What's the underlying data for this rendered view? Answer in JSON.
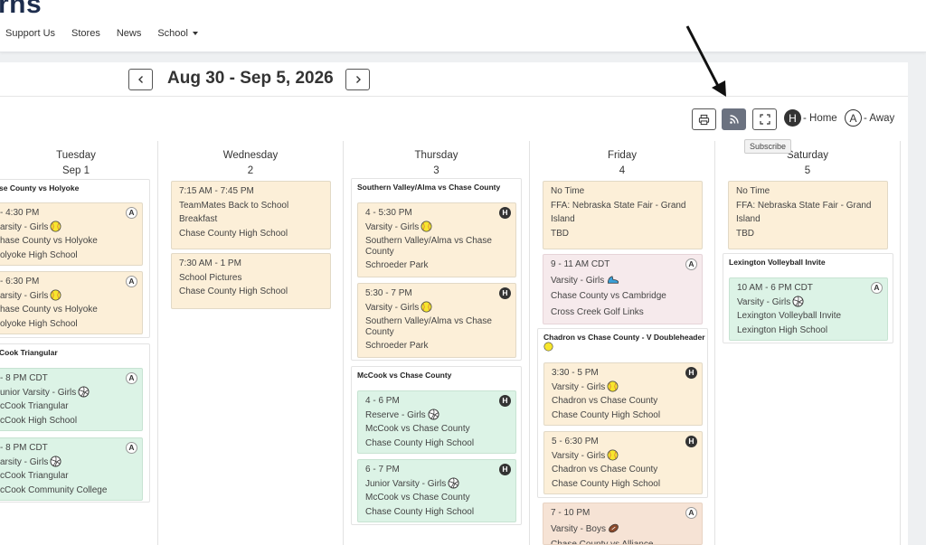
{
  "header": {
    "brand": "rns",
    "nav": [
      "Support Us",
      "Stores",
      "News",
      "School"
    ]
  },
  "week": {
    "title": "Aug 30 - Sep 5, 2026"
  },
  "toolbar": {
    "tooltip": "Subscribe"
  },
  "legend": {
    "home_letter": "H",
    "home_label": "- Home",
    "away_letter": "A",
    "away_label": "- Away"
  },
  "days": [
    {
      "name": "Tuesday",
      "date": "Sep 1"
    },
    {
      "name": "Wednesday",
      "date": "2"
    },
    {
      "name": "Thursday",
      "date": "3"
    },
    {
      "name": "Friday",
      "date": "4"
    },
    {
      "name": "Saturday",
      "date": "5"
    }
  ],
  "tuesday": {
    "g1": {
      "title": "se County vs Holyoke",
      "e1": {
        "time": "- 4:30 PM",
        "level": "arsity - Girls",
        "match": "hase County vs Holyoke",
        "venue": "olyoke High School",
        "badge": "A"
      },
      "e2": {
        "time": "- 6:30 PM",
        "level": "arsity - Girls",
        "match": "hase County vs Holyoke",
        "venue": "olyoke High School",
        "badge": "A"
      }
    },
    "g2": {
      "title": "Cook Triangular",
      "e1": {
        "time": "- 8 PM CDT",
        "level": "unior Varsity - Girls",
        "match": "cCook Triangular",
        "venue": "cCook High School",
        "badge": "A"
      },
      "e2": {
        "time": "- 8 PM CDT",
        "level": "arsity - Girls",
        "match": "cCook Triangular",
        "venue": "cCook Community College",
        "badge": "A"
      }
    }
  },
  "wednesday": {
    "e1": {
      "time": "7:15 AM - 7:45 PM",
      "title": "TeamMates Back to School Breakfast",
      "venue": "Chase County High School"
    },
    "e2": {
      "time": "7:30 AM - 1 PM",
      "title": "School Pictures",
      "venue": "Chase County High School"
    }
  },
  "thursday": {
    "g1": {
      "title": "Southern Valley/Alma vs Chase County",
      "e1": {
        "time": "4 - 5:30 PM",
        "level": "Varsity - Girls",
        "match": "Southern Valley/Alma vs Chase County",
        "venue": "Schroeder Park",
        "badge": "H"
      },
      "e2": {
        "time": "5:30 - 7 PM",
        "level": "Varsity - Girls",
        "match": "Southern Valley/Alma vs Chase County",
        "venue": "Schroeder Park",
        "badge": "H"
      }
    },
    "g2": {
      "title": "McCook vs Chase County",
      "e1": {
        "time": "4 - 6 PM",
        "level": "Reserve - Girls",
        "match": "McCook vs Chase County",
        "venue": "Chase County High School",
        "badge": "H"
      },
      "e2": {
        "time": "6 - 7 PM",
        "level": "Junior Varsity - Girls",
        "match": "McCook vs Chase County",
        "venue": "Chase County High School",
        "badge": "H"
      }
    }
  },
  "friday": {
    "e1": {
      "time": "No Time",
      "title": "FFA: Nebraska State Fair - Grand Island",
      "venue": "TBD"
    },
    "e2": {
      "time": "9 - 11 AM CDT",
      "level": "Varsity - Girls",
      "match": "Chase County vs Cambridge",
      "venue": "Cross Creek Golf Links",
      "badge": "A"
    },
    "g1": {
      "title": "Chadron vs Chase County - V Doubleheader",
      "e1": {
        "time": "3:30 - 5 PM",
        "level": "Varsity - Girls",
        "match": "Chadron vs Chase County",
        "venue": "Chase County High School",
        "badge": "H"
      },
      "e2": {
        "time": "5 - 6:30 PM",
        "level": "Varsity - Girls",
        "match": "Chadron vs Chase County",
        "venue": "Chase County High School",
        "badge": "H"
      }
    },
    "e3": {
      "time": "7 - 10 PM",
      "level": "Varsity - Boys",
      "match": "Chase County vs Alliance",
      "badge": "A"
    }
  },
  "saturday": {
    "e1": {
      "time": "No Time",
      "title": "FFA: Nebraska State Fair - Grand Island",
      "venue": "TBD"
    },
    "g1": {
      "title": "Lexington Volleyball Invite",
      "e1": {
        "time": "10 AM - 6 PM CDT",
        "level": "Varsity - Girls",
        "match": "Lexington Volleyball Invite",
        "venue": "Lexington High School",
        "badge": "A"
      }
    }
  },
  "colors": {
    "home_badge": "#333333",
    "event_yellow": "#fcefd8",
    "event_green": "#dcf3e6",
    "event_pink": "#f6eaec",
    "event_brown": "#f6e3d5",
    "toolbar_active": "#6b7280"
  },
  "icons": {
    "softball": "softball-icon",
    "volleyball": "volleyball-icon",
    "golf": "golf-shoe-icon",
    "football": "football-icon"
  }
}
